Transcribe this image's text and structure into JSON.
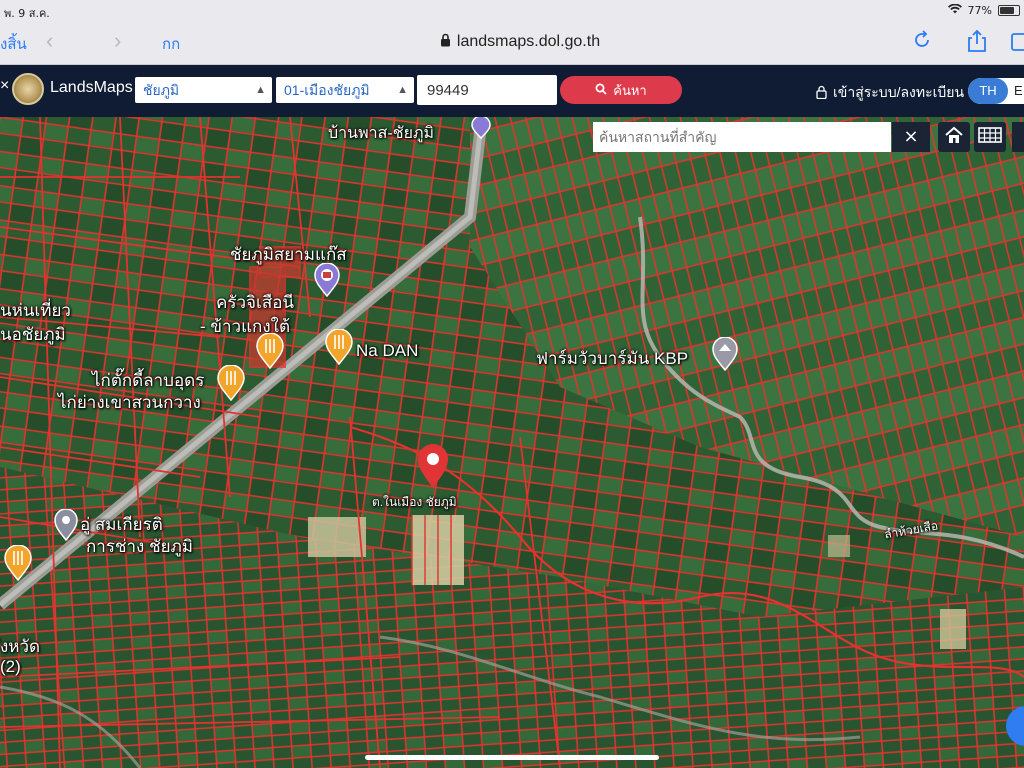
{
  "status_bar": {
    "time": "พ. 9 ส.ค.",
    "battery": "77%"
  },
  "safari": {
    "done_label": "งสิ้น",
    "aa_label": "กก",
    "url": "landsmaps.dol.go.th"
  },
  "header": {
    "brand": "LandsMaps",
    "province": "ชัยภูมิ",
    "district": "01-เมืองชัยภูมิ",
    "parcel_value": "99449",
    "search_label": "ค้นหา",
    "login_label": "เข้าสู่ระบบ/ลงทะเบียน",
    "lang_active": "TH",
    "lang_other": "E"
  },
  "map": {
    "place_search_placeholder": "ค้นหาสถานที่สำคัญ",
    "labels": {
      "top_road": "บ้านพาส-ชัยภูมิ",
      "gas": "ชัยภูมิสยามแก๊ส",
      "krua_1": "ครัวจิเสือนี",
      "krua_2": "- ข้าวแกงใต้",
      "left_1": "นห่นเที่ยว",
      "left_2": "นอชัยภูมิ",
      "nadan": "Na DAN",
      "kai_1": "ไก่ตั๊กดี้ลาบอุดร",
      "kai_2": "ไก่ย่างเขาสวนกวาง",
      "farm": "ฟาร์มวัวบาร์มัน KBP",
      "pin_label": "ต.ในเมือง ชัยภูมิ",
      "shop_1": "อู่ สมเกียรติ",
      "shop_2": "การช่าง ชัยภูมิ",
      "river": "ลำห้วยเสือ",
      "bottom_1": "ังหวัด",
      "bottom_2": "(2)"
    }
  }
}
